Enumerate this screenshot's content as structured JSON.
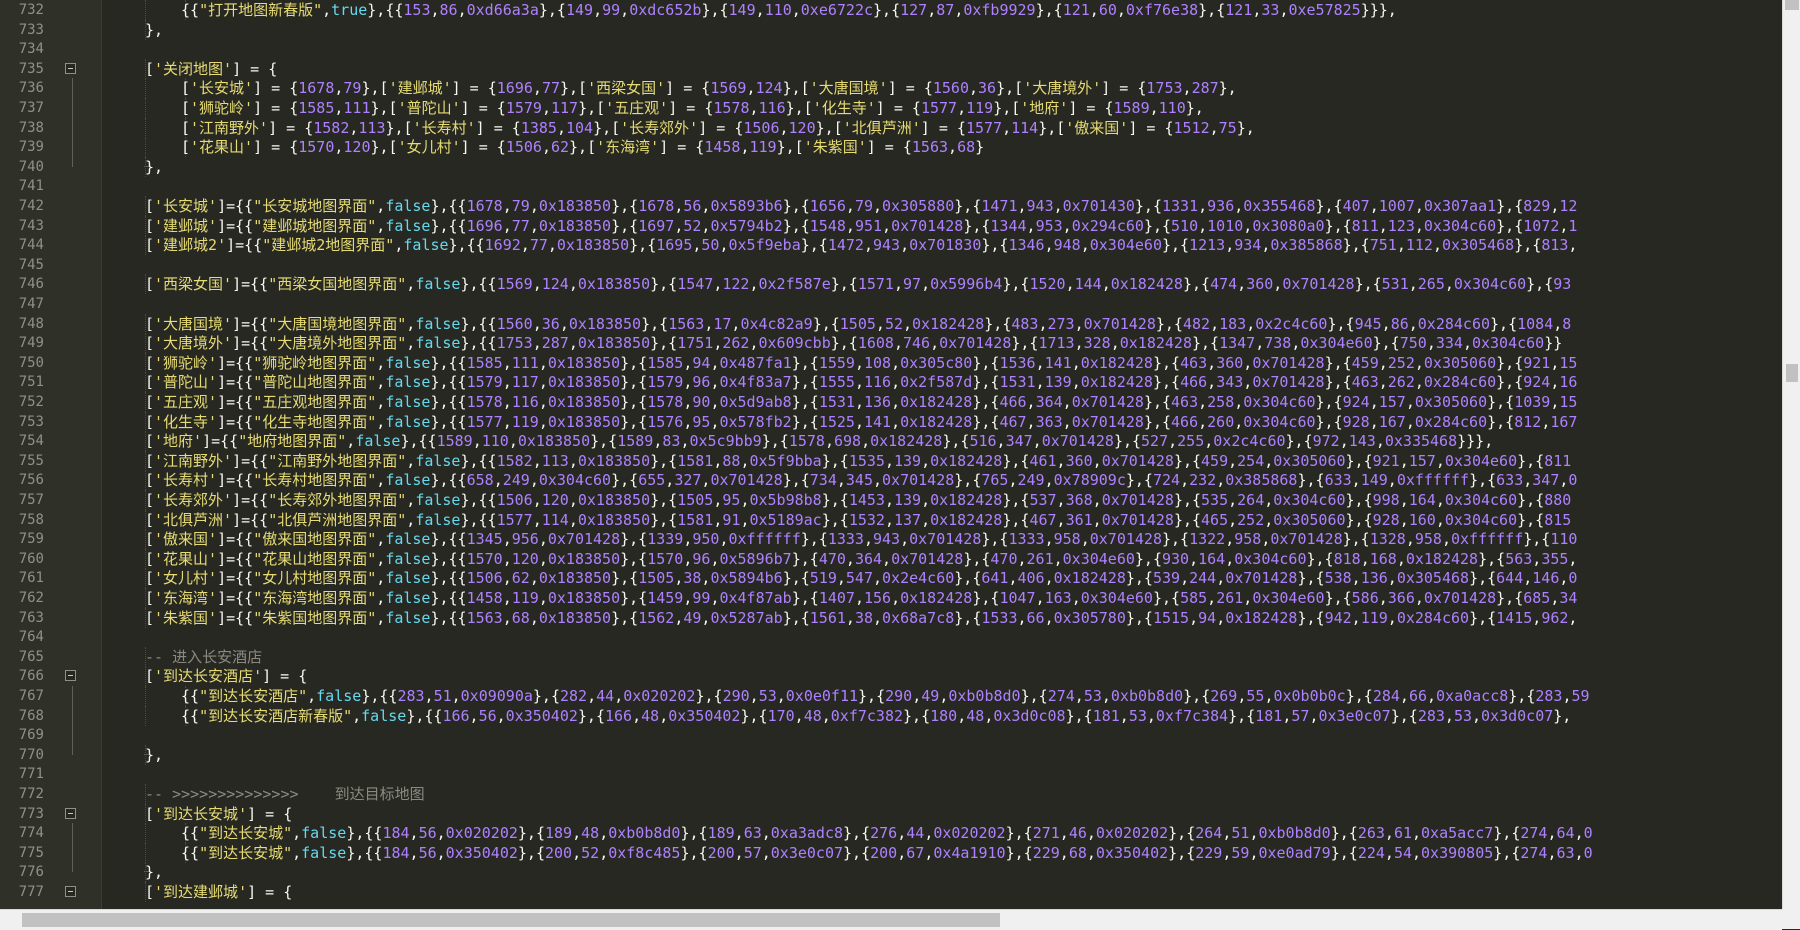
{
  "editor": {
    "lines": [
      {
        "n": "732",
        "indent": 3,
        "text": "{{\"打开地图新春版\",true},{{153,86,0xd66a3a},{149,99,0xdc652b},{149,110,0xe6722c},{127,87,0xfb9929},{121,60,0xf76e38},{121,33,0xe57825}}},"
      },
      {
        "n": "733",
        "indent": 2,
        "text": "},"
      },
      {
        "n": "734",
        "indent": 0,
        "text": ""
      },
      {
        "n": "735",
        "indent": 2,
        "fold": "open",
        "text": "['关闭地图'] = {"
      },
      {
        "n": "736",
        "indent": 3,
        "text": "['长安城'] = {1678,79},['建邺城'] = {1696,77},['西梁女国'] = {1569,124},['大唐国境'] = {1560,36},['大唐境外'] = {1753,287},"
      },
      {
        "n": "737",
        "indent": 3,
        "text": "['狮驼岭'] = {1585,111},['普陀山'] = {1579,117},['五庄观'] = {1578,116},['化生寺'] = {1577,119},['地府'] = {1589,110},"
      },
      {
        "n": "738",
        "indent": 3,
        "text": "['江南野外'] = {1582,113},['长寿村'] = {1385,104},['长寿郊外'] = {1506,120},['北俱芦洲'] = {1577,114},['傲来国'] = {1512,75},"
      },
      {
        "n": "739",
        "indent": 3,
        "text": "['花果山'] = {1570,120},['女儿村'] = {1506,62},['东海湾'] = {1458,119},['朱紫国'] = {1563,68}"
      },
      {
        "n": "740",
        "indent": 2,
        "fold": "end",
        "text": "},"
      },
      {
        "n": "741",
        "indent": 0,
        "text": ""
      },
      {
        "n": "742",
        "indent": 2,
        "text": "['长安城']={{\"长安城地图界面\",false},{{1678,79,0x183850},{1678,56,0x5893b6},{1656,79,0x305880},{1471,943,0x701430},{1331,936,0x355468},{407,1007,0x307aa1},{829,12"
      },
      {
        "n": "743",
        "indent": 2,
        "text": "['建邺城']={{\"建邺城地图界面\",false},{{1696,77,0x183850},{1697,52,0x5794b2},{1548,951,0x701428},{1344,953,0x294c60},{510,1010,0x3080a0},{811,123,0x304c60},{1072,1"
      },
      {
        "n": "744",
        "indent": 2,
        "text": "['建邺城2']={{\"建邺城2地图界面\",false},{{1692,77,0x183850},{1695,50,0x5f9eba},{1472,943,0x701830},{1346,948,0x304e60},{1213,934,0x385868},{751,112,0x305468},{813,"
      },
      {
        "n": "745",
        "indent": 0,
        "text": ""
      },
      {
        "n": "746",
        "indent": 2,
        "text": "['西梁女国']={{\"西梁女国地图界面\",false},{{1569,124,0x183850},{1547,122,0x2f587e},{1571,97,0x5996b4},{1520,144,0x182428},{474,360,0x701428},{531,265,0x304c60},{93"
      },
      {
        "n": "747",
        "indent": 0,
        "text": ""
      },
      {
        "n": "748",
        "indent": 2,
        "text": "['大唐国境']={{\"大唐国境地图界面\",false},{{1560,36,0x183850},{1563,17,0x4c82a9},{1505,52,0x182428},{483,273,0x701428},{482,183,0x2c4c60},{945,86,0x284c60},{1084,8"
      },
      {
        "n": "749",
        "indent": 2,
        "text": "['大唐境外']={{\"大唐境外地图界面\",false},{{1753,287,0x183850},{1751,262,0x609cbb},{1608,746,0x701428},{1713,328,0x182428},{1347,738,0x304e60},{750,334,0x304c60}}"
      },
      {
        "n": "750",
        "indent": 2,
        "text": "['狮驼岭']={{\"狮驼岭地图界面\",false},{{1585,111,0x183850},{1585,94,0x487fa1},{1559,108,0x305c80},{1536,141,0x182428},{463,360,0x701428},{459,252,0x305060},{921,15"
      },
      {
        "n": "751",
        "indent": 2,
        "text": "['普陀山']={{\"普陀山地图界面\",false},{{1579,117,0x183850},{1579,96,0x4f83a7},{1555,116,0x2f587d},{1531,139,0x182428},{466,343,0x701428},{463,262,0x284c60},{924,16"
      },
      {
        "n": "752",
        "indent": 2,
        "text": "['五庄观']={{\"五庄观地图界面\",false},{{1578,116,0x183850},{1578,90,0x5d9ab8},{1531,136,0x182428},{466,364,0x701428},{463,258,0x304c60},{924,157,0x305060},{1039,15"
      },
      {
        "n": "753",
        "indent": 2,
        "text": "['化生寺']={{\"化生寺地图界面\",false},{{1577,119,0x183850},{1576,95,0x578fb2},{1525,141,0x182428},{467,363,0x701428},{466,260,0x304c60},{928,167,0x284c60},{812,167"
      },
      {
        "n": "754",
        "indent": 2,
        "text": "['地府']={{\"地府地图界面\",false},{{1589,110,0x183850},{1589,83,0x5c9bb9},{1578,698,0x182428},{516,347,0x701428},{527,255,0x2c4c60},{972,143,0x335468}}},"
      },
      {
        "n": "755",
        "indent": 2,
        "text": "['江南野外']={{\"江南野外地图界面\",false},{{1582,113,0x183850},{1581,88,0x5f9bba},{1535,139,0x182428},{461,360,0x701428},{459,254,0x305060},{921,157,0x304e60},{811"
      },
      {
        "n": "756",
        "indent": 2,
        "text": "['长寿村']={{\"长寿村地图界面\",false},{{658,249,0x304c60},{655,327,0x701428},{734,345,0x701428},{765,249,0x78909c},{724,232,0x385868},{633,149,0xffffff},{633,347,0"
      },
      {
        "n": "757",
        "indent": 2,
        "text": "['长寿郊外']={{\"长寿郊外地图界面\",false},{{1506,120,0x183850},{1505,95,0x5b98b8},{1453,139,0x182428},{537,368,0x701428},{535,264,0x304c60},{998,164,0x304c60},{880"
      },
      {
        "n": "758",
        "indent": 2,
        "text": "['北俱芦洲']={{\"北俱芦洲地图界面\",false},{{1577,114,0x183850},{1581,91,0x5189ac},{1532,137,0x182428},{467,361,0x701428},{465,252,0x305060},{928,160,0x304c60},{815"
      },
      {
        "n": "759",
        "indent": 2,
        "text": "['傲来国']={{\"傲来国地图界面\",false},{{1345,956,0x701428},{1339,950,0xffffff},{1333,943,0x701428},{1333,958,0x701428},{1322,958,0x701428},{1328,958,0xffffff},{110"
      },
      {
        "n": "760",
        "indent": 2,
        "text": "['花果山']={{\"花果山地图界面\",false},{{1570,120,0x183850},{1570,96,0x5896b7},{470,364,0x701428},{470,261,0x304e60},{930,164,0x304c60},{818,168,0x182428},{563,355,"
      },
      {
        "n": "761",
        "indent": 2,
        "text": "['女儿村']={{\"女儿村地图界面\",false},{{1506,62,0x183850},{1505,38,0x5894b6},{519,547,0x2e4c60},{641,406,0x182428},{539,244,0x701428},{538,136,0x305468},{644,146,0"
      },
      {
        "n": "762",
        "indent": 2,
        "text": "['东海湾']={{\"东海湾地图界面\",false},{{1458,119,0x183850},{1459,99,0x4f87ab},{1407,156,0x182428},{1047,163,0x304e60},{585,261,0x304e60},{586,366,0x701428},{685,34"
      },
      {
        "n": "763",
        "indent": 2,
        "text": "['朱紫国']={{\"朱紫国地图界面\",false},{{1563,68,0x183850},{1562,49,0x5287ab},{1561,38,0x68a7c8},{1533,66,0x305780},{1515,94,0x182428},{942,119,0x284c60},{1415,962,"
      },
      {
        "n": "764",
        "indent": 0,
        "text": ""
      },
      {
        "n": "765",
        "indent": 2,
        "comment": true,
        "text": "-- 进入长安酒店"
      },
      {
        "n": "766",
        "indent": 2,
        "fold": "open",
        "text": "['到达长安酒店'] = {"
      },
      {
        "n": "767",
        "indent": 3,
        "text": "{{\"到达长安酒店\",false},{{283,51,0x09090a},{282,44,0x020202},{290,53,0x0e0f11},{290,49,0xb0b8d0},{274,53,0xb0b8d0},{269,55,0x0b0b0c},{284,66,0xa0acc8},{283,59"
      },
      {
        "n": "768",
        "indent": 3,
        "text": "{{\"到达长安酒店新春版\",false},{{166,56,0x350402},{166,48,0x350402},{170,48,0xf7c382},{180,48,0x3d0c08},{181,53,0xf7c384},{181,57,0x3e0c07},{283,53,0x3d0c07},"
      },
      {
        "n": "769",
        "indent": 0,
        "text": ""
      },
      {
        "n": "770",
        "indent": 2,
        "fold": "end",
        "text": "},"
      },
      {
        "n": "771",
        "indent": 0,
        "text": ""
      },
      {
        "n": "772",
        "indent": 2,
        "comment": true,
        "text": "-- >>>>>>>>>>>>>>    到达目标地图"
      },
      {
        "n": "773",
        "indent": 2,
        "fold": "open",
        "text": "['到达长安城'] = {"
      },
      {
        "n": "774",
        "indent": 3,
        "text": "{{\"到达长安城\",false},{{184,56,0x020202},{189,48,0xb0b8d0},{189,63,0xa3adc8},{276,44,0x020202},{271,46,0x020202},{264,51,0xb0b8d0},{263,61,0xa5acc7},{274,64,0"
      },
      {
        "n": "775",
        "indent": 3,
        "text": "{{\"到达长安城\",false},{{184,56,0x350402},{200,52,0xf8c485},{200,57,0x3e0c07},{200,67,0x4a1910},{229,68,0x350402},{229,59,0xe0ad79},{224,54,0x390805},{274,63,0"
      },
      {
        "n": "776",
        "indent": 2,
        "fold": "end",
        "text": "},"
      },
      {
        "n": "777",
        "indent": 2,
        "fold": "open",
        "text": "['到达建邺城'] = {"
      }
    ]
  }
}
